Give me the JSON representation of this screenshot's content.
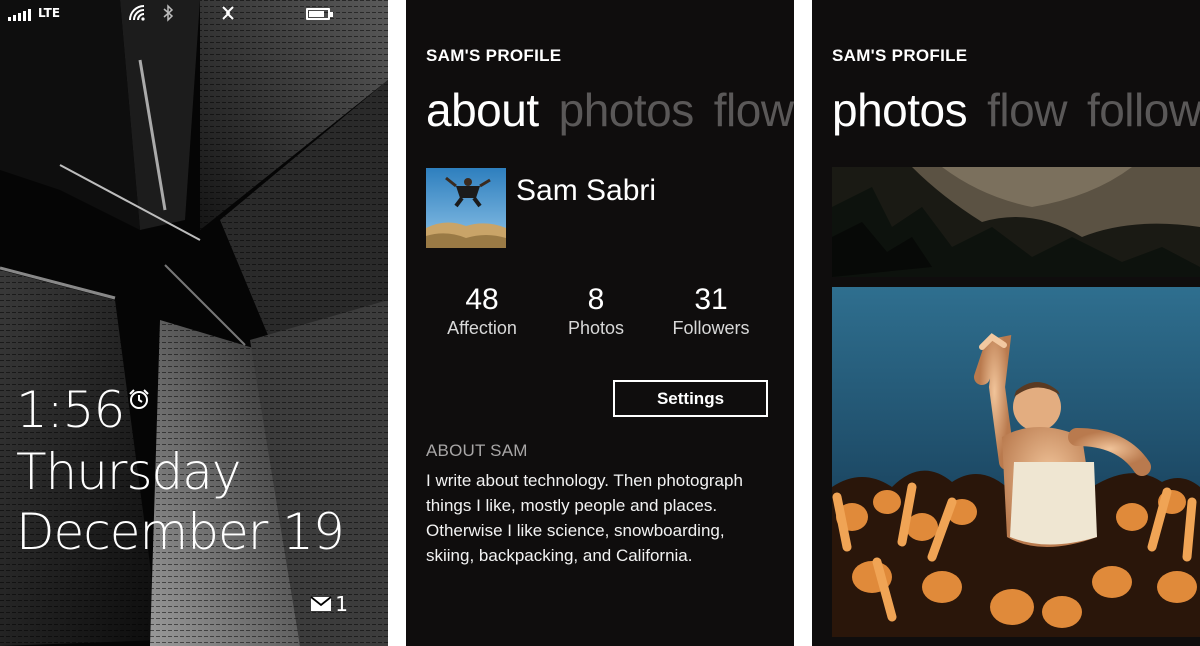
{
  "lock_screen": {
    "status": {
      "network": "LTE",
      "icons": [
        "signal-icon",
        "wifi-icon",
        "bluetooth-icon",
        "sync-icon",
        "battery-icon"
      ],
      "battery_level": 0.85
    },
    "time": "1:56",
    "day": "Thursday",
    "date": "December 19",
    "mail_count": "1"
  },
  "about_panel": {
    "app_title": "SAM'S PROFILE",
    "pivot": [
      "about",
      "photos",
      "flow"
    ],
    "profile_name": "Sam Sabri",
    "stats": [
      {
        "value": "48",
        "label": "Affection"
      },
      {
        "value": "8",
        "label": "Photos"
      },
      {
        "value": "31",
        "label": "Followers"
      }
    ],
    "settings_label": "Settings",
    "about_heading": "ABOUT SAM",
    "about_text": "I write about technology. Then photograph things I like, mostly people and places. Otherwise I like science, snowboarding, skiing, backpacking, and California."
  },
  "photos_panel": {
    "app_title": "SAM'S PROFILE",
    "pivot": [
      "photos",
      "flow",
      "follow"
    ]
  },
  "colors": {
    "background": "#0f0d0d",
    "inactive_pivot": "#5a5858",
    "text": "#ffffff"
  }
}
